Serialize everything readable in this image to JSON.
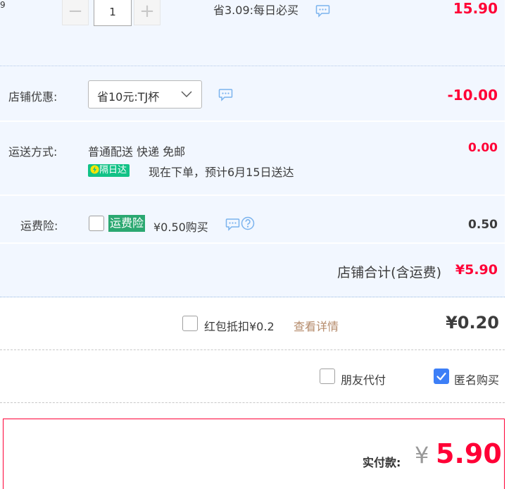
{
  "item": {
    "edge_text": "9",
    "quantity": "1",
    "savings_text": "省3.09:每日必买",
    "subtotal": "15.90"
  },
  "shop_discount": {
    "label": "店铺优惠:",
    "selected_option": "省10元:TJ杯",
    "amount": "-10.00"
  },
  "shipping": {
    "label": "运送方式:",
    "method": "普通配送 快递 免邮",
    "badge": "隔日达",
    "eta": "现在下单，预计6月15日送达",
    "amount": "0.00"
  },
  "insurance": {
    "label": "运费险:",
    "tag": "运费险",
    "price_text": "¥0.50购买",
    "amount": "0.50"
  },
  "shop_total": {
    "label": "店铺合计(含运费)",
    "amount": "¥5.90"
  },
  "red_packet": {
    "label": "红包抵扣¥0.2",
    "details_link": "查看详情",
    "amount": "¥0.20"
  },
  "options": {
    "friend_pay": "朋友代付",
    "anonymous": "匿名购买",
    "anonymous_checked": true
  },
  "payment": {
    "label": "实付款:",
    "currency": "¥",
    "amount": "5.90"
  },
  "colors": {
    "accent_red": "#ff0036",
    "panel_blue": "#f2f7ff",
    "checkbox_blue": "#3d7ff7",
    "tag_green": "#2ba871"
  }
}
